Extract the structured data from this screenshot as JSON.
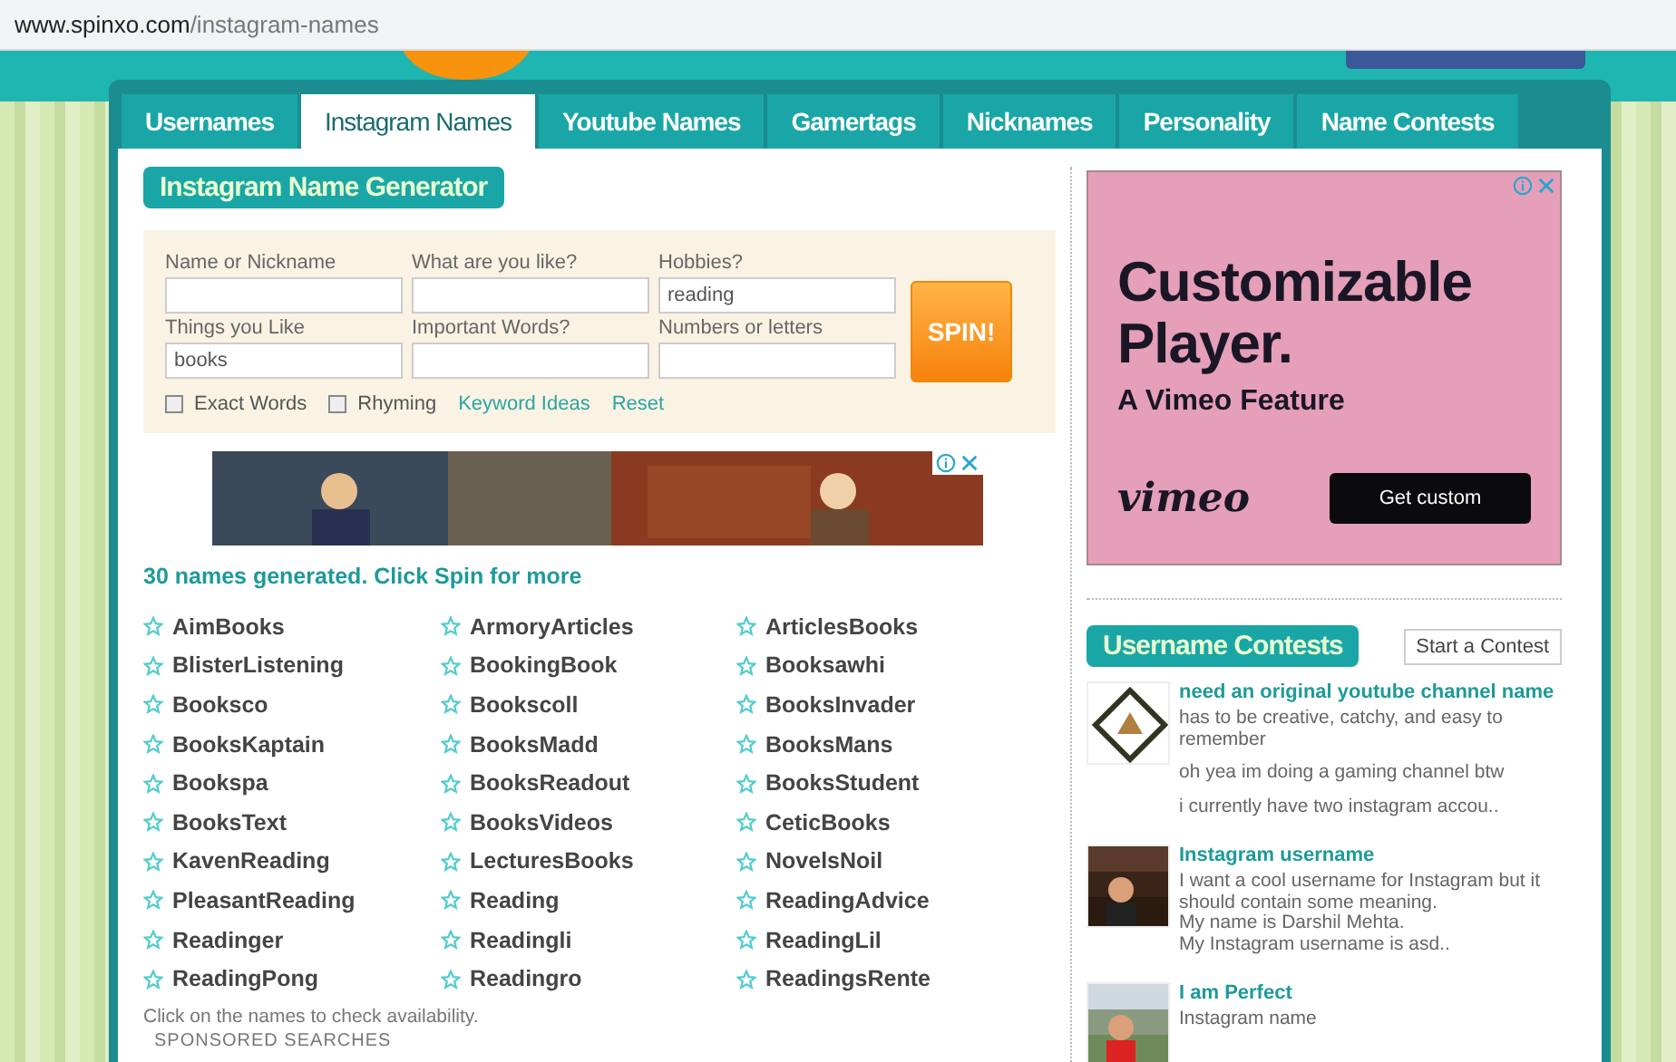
{
  "address_bar": {
    "host": "www.spinxo.com",
    "path": "/instagram-names"
  },
  "tabs": [
    {
      "label": "Usernames",
      "selected": false
    },
    {
      "label": "Instagram Names",
      "selected": true
    },
    {
      "label": "Youtube Names",
      "selected": false
    },
    {
      "label": "Gamertags",
      "selected": false
    },
    {
      "label": "Nicknames",
      "selected": false
    },
    {
      "label": "Personality",
      "selected": false
    },
    {
      "label": "Name Contests",
      "selected": false
    }
  ],
  "generator": {
    "title": "Instagram Name Generator",
    "fields": [
      {
        "label": "Name or Nickname"
      },
      {
        "label": "What are you like?"
      },
      {
        "label": "Hobbies?",
        "value": "reading"
      },
      {
        "label": "Things you Like",
        "value": "books"
      },
      {
        "label": "Important Words?"
      },
      {
        "label": "Numbers or letters"
      }
    ],
    "spin_button": "SPIN!",
    "options": [
      {
        "label": "Exact Words",
        "checked": false
      },
      {
        "label": "Rhyming",
        "checked": false
      }
    ],
    "links": [
      "Keyword Ideas",
      "Reset"
    ]
  },
  "results": {
    "summary": "30 names generated. Click Spin for more",
    "names": [
      "AimBooks",
      "ArmoryArticles",
      "ArticlesBooks",
      "BlisterListening",
      "BookingBook",
      "Booksawhi",
      "Booksco",
      "Bookscoll",
      "BooksInvader",
      "BooksKaptain",
      "BooksMadd",
      "BooksMans",
      "Bookspa",
      "BooksReadout",
      "BooksStudent",
      "BooksText",
      "BooksVideos",
      "CeticBooks",
      "KavenReading",
      "LecturesBooks",
      "NovelsNoil",
      "PleasantReading",
      "Reading",
      "ReadingAdvice",
      "Readinger",
      "Readingli",
      "ReadingLil",
      "ReadingPong",
      "Readingro",
      "ReadingsRente"
    ],
    "hint": "Click on the names to check availability.",
    "sponsored": "SPONSORED SEARCHES"
  },
  "side_ad": {
    "headline": "Customizable Player.",
    "subhead": "A Vimeo Feature",
    "brand": "vimeo",
    "button": "Get custom"
  },
  "contests": {
    "title": "Username Contests",
    "start_button": "Start a Contest",
    "items": [
      {
        "kind": "sign",
        "title": "need an original youtube channel name",
        "paragraphs": [
          "has to be creative, catchy, and easy to remember",
          "oh yea im doing a gaming channel btw",
          "i currently have two instagram accou.."
        ]
      },
      {
        "title": "Instagram username",
        "paragraphs": [
          "I want a cool username for Instagram but it should contain some meaning.\nMy name is Darshil Mehta.\nMy Instagram username is asd.."
        ]
      },
      {
        "title": "I am Perfect",
        "paragraphs": [
          "Instagram name"
        ]
      }
    ]
  }
}
